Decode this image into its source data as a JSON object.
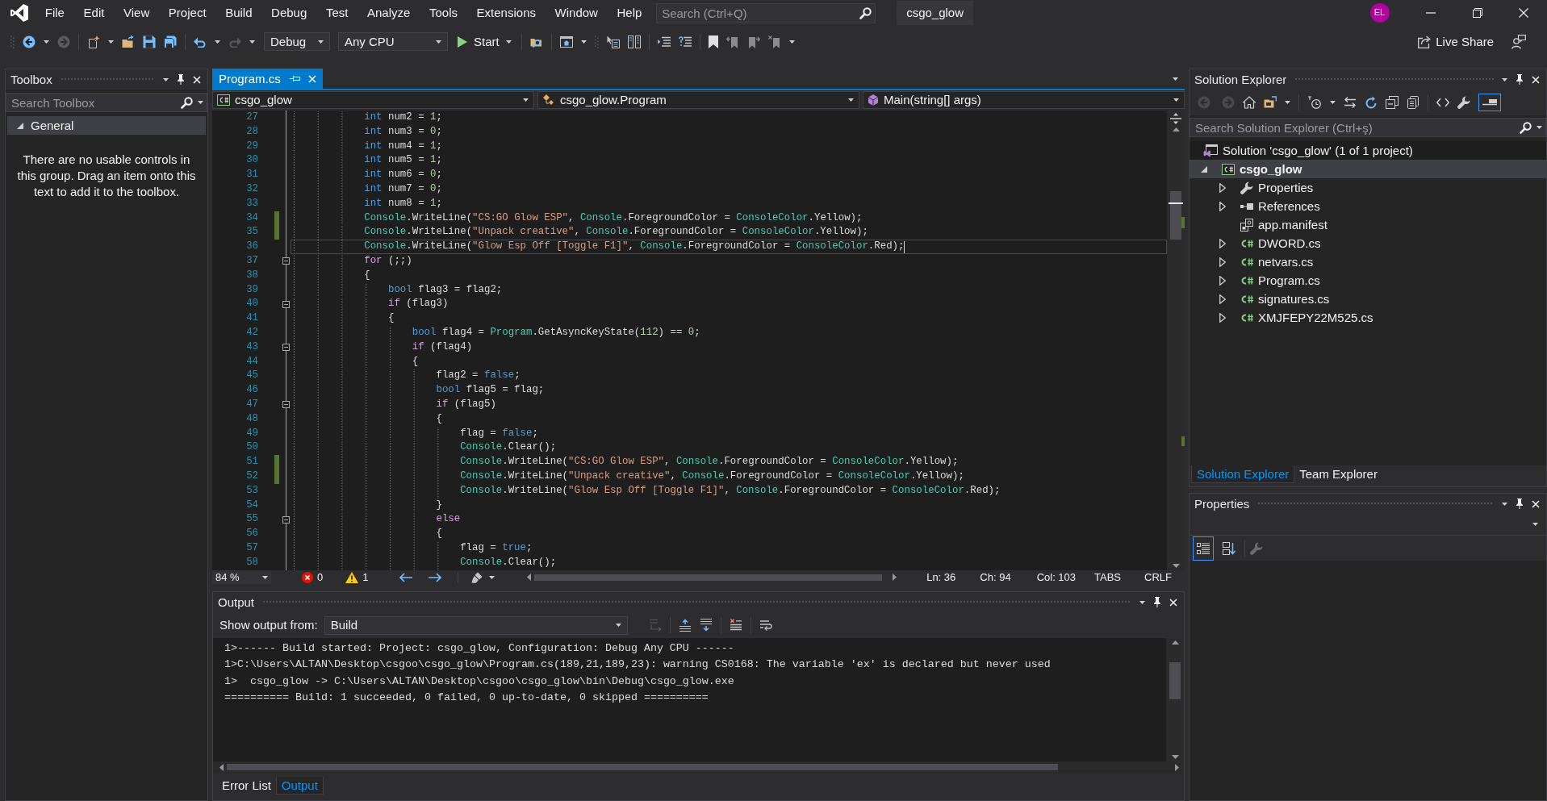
{
  "menu_bar": {
    "items": [
      "File",
      "Edit",
      "View",
      "Project",
      "Build",
      "Debug",
      "Test",
      "Analyze",
      "Tools",
      "Extensions",
      "Window",
      "Help"
    ],
    "search": {
      "placeholder": "Search (Ctrl+Q)"
    },
    "solution_name": "csgo_glow",
    "account_initials": "EL"
  },
  "toolbar": {
    "configuration": "Debug",
    "platform": "Any CPU",
    "start": "Start",
    "live_share": "Live Share"
  },
  "toolbox": {
    "title": "Toolbox",
    "search": {
      "placeholder": "Search Toolbox"
    },
    "groups": [
      {
        "label": "General",
        "expanded": true,
        "message": "There are no usable controls in this group. Drag an item onto this text to add it to the toolbox."
      }
    ]
  },
  "editor": {
    "tabs": [
      {
        "label": "Program.cs",
        "selected": true
      }
    ],
    "navigation": {
      "project": "csgo_glow",
      "type": "csgo_glow.Program",
      "member": "Main(string[] args)"
    },
    "lines": [
      {
        "number": "27",
        "changed": false,
        "current": false,
        "foldable": false,
        "tokens": [
          {
            "kind": "keyword",
            "text": "            int"
          },
          {
            "kind": "plain",
            "text": " num2 = "
          },
          {
            "kind": "number",
            "text": "1"
          },
          {
            "kind": "plain",
            "text": ";"
          }
        ]
      },
      {
        "number": "28",
        "changed": false,
        "current": false,
        "foldable": false,
        "tokens": [
          {
            "kind": "keyword",
            "text": "            int"
          },
          {
            "kind": "plain",
            "text": " num3 = "
          },
          {
            "kind": "number",
            "text": "0"
          },
          {
            "kind": "plain",
            "text": ";"
          }
        ]
      },
      {
        "number": "29",
        "changed": false,
        "current": false,
        "foldable": false,
        "tokens": [
          {
            "kind": "keyword",
            "text": "            int"
          },
          {
            "kind": "plain",
            "text": " num4 = "
          },
          {
            "kind": "number",
            "text": "1"
          },
          {
            "kind": "plain",
            "text": ";"
          }
        ]
      },
      {
        "number": "30",
        "changed": false,
        "current": false,
        "foldable": false,
        "tokens": [
          {
            "kind": "keyword",
            "text": "            int"
          },
          {
            "kind": "plain",
            "text": " num5 = "
          },
          {
            "kind": "number",
            "text": "1"
          },
          {
            "kind": "plain",
            "text": ";"
          }
        ]
      },
      {
        "number": "31",
        "changed": false,
        "current": false,
        "foldable": false,
        "tokens": [
          {
            "kind": "keyword",
            "text": "            int"
          },
          {
            "kind": "plain",
            "text": " num6 = "
          },
          {
            "kind": "number",
            "text": "0"
          },
          {
            "kind": "plain",
            "text": ";"
          }
        ]
      },
      {
        "number": "32",
        "changed": false,
        "current": false,
        "foldable": false,
        "tokens": [
          {
            "kind": "keyword",
            "text": "            int"
          },
          {
            "kind": "plain",
            "text": " num7 = "
          },
          {
            "kind": "number",
            "text": "0"
          },
          {
            "kind": "plain",
            "text": ";"
          }
        ]
      },
      {
        "number": "33",
        "changed": false,
        "current": false,
        "foldable": false,
        "tokens": [
          {
            "kind": "keyword",
            "text": "            int"
          },
          {
            "kind": "plain",
            "text": " num8 = "
          },
          {
            "kind": "number",
            "text": "1"
          },
          {
            "kind": "plain",
            "text": ";"
          }
        ]
      },
      {
        "number": "34",
        "changed": true,
        "current": false,
        "foldable": false,
        "tokens": [
          {
            "kind": "type",
            "text": "            Console"
          },
          {
            "kind": "plain",
            "text": ".WriteLine("
          },
          {
            "kind": "string",
            "text": "\"CS:GO Glow ESP\""
          },
          {
            "kind": "plain",
            "text": ", "
          },
          {
            "kind": "type",
            "text": "Console"
          },
          {
            "kind": "plain",
            "text": ".ForegroundColor = "
          },
          {
            "kind": "type",
            "text": "ConsoleColor"
          },
          {
            "kind": "plain",
            "text": ".Yellow);"
          }
        ]
      },
      {
        "number": "35",
        "changed": true,
        "current": false,
        "foldable": false,
        "tokens": [
          {
            "kind": "type",
            "text": "            Console"
          },
          {
            "kind": "plain",
            "text": ".WriteLine("
          },
          {
            "kind": "string",
            "text": "\"Unpack creative\""
          },
          {
            "kind": "plain",
            "text": ", "
          },
          {
            "kind": "type",
            "text": "Console"
          },
          {
            "kind": "plain",
            "text": ".ForegroundColor = "
          },
          {
            "kind": "type",
            "text": "ConsoleColor"
          },
          {
            "kind": "plain",
            "text": ".Yellow);"
          }
        ]
      },
      {
        "number": "36",
        "changed": false,
        "current": true,
        "foldable": false,
        "tokens": [
          {
            "kind": "type",
            "text": "            Console"
          },
          {
            "kind": "plain",
            "text": ".WriteLine("
          },
          {
            "kind": "string",
            "text": "\"Glow Esp Off [Toggle F1]\""
          },
          {
            "kind": "plain",
            "text": ", "
          },
          {
            "kind": "type",
            "text": "Console"
          },
          {
            "kind": "plain",
            "text": ".ForegroundColor = "
          },
          {
            "kind": "type",
            "text": "ConsoleColor"
          },
          {
            "kind": "plain",
            "text": ".Red);"
          }
        ]
      },
      {
        "number": "37",
        "changed": false,
        "current": false,
        "foldable": true,
        "tokens": [
          {
            "kind": "control",
            "text": "            for"
          },
          {
            "kind": "plain",
            "text": " (;;)"
          }
        ]
      },
      {
        "number": "38",
        "changed": false,
        "current": false,
        "foldable": false,
        "tokens": [
          {
            "kind": "plain",
            "text": "            {"
          }
        ]
      },
      {
        "number": "39",
        "changed": false,
        "current": false,
        "foldable": false,
        "tokens": [
          {
            "kind": "keyword",
            "text": "                bool"
          },
          {
            "kind": "plain",
            "text": " flag3 = flag2;"
          }
        ]
      },
      {
        "number": "40",
        "changed": false,
        "current": false,
        "foldable": true,
        "tokens": [
          {
            "kind": "control",
            "text": "                if"
          },
          {
            "kind": "plain",
            "text": " (flag3)"
          }
        ]
      },
      {
        "number": "41",
        "changed": false,
        "current": false,
        "foldable": false,
        "tokens": [
          {
            "kind": "plain",
            "text": "                {"
          }
        ]
      },
      {
        "number": "42",
        "changed": false,
        "current": false,
        "foldable": false,
        "tokens": [
          {
            "kind": "keyword",
            "text": "                    bool"
          },
          {
            "kind": "plain",
            "text": " flag4 = "
          },
          {
            "kind": "type",
            "text": "Program"
          },
          {
            "kind": "plain",
            "text": ".GetAsyncKeyState("
          },
          {
            "kind": "number",
            "text": "112"
          },
          {
            "kind": "plain",
            "text": ") == "
          },
          {
            "kind": "number",
            "text": "0"
          },
          {
            "kind": "plain",
            "text": ";"
          }
        ]
      },
      {
        "number": "43",
        "changed": false,
        "current": false,
        "foldable": true,
        "tokens": [
          {
            "kind": "control",
            "text": "                    if"
          },
          {
            "kind": "plain",
            "text": " (flag4)"
          }
        ]
      },
      {
        "number": "44",
        "changed": false,
        "current": false,
        "foldable": false,
        "tokens": [
          {
            "kind": "plain",
            "text": "                    {"
          }
        ]
      },
      {
        "number": "45",
        "changed": false,
        "current": false,
        "foldable": false,
        "tokens": [
          {
            "kind": "plain",
            "text": "                        flag2 = "
          },
          {
            "kind": "keyword",
            "text": "false"
          },
          {
            "kind": "plain",
            "text": ";"
          }
        ]
      },
      {
        "number": "46",
        "changed": false,
        "current": false,
        "foldable": false,
        "tokens": [
          {
            "kind": "keyword",
            "text": "                        bool"
          },
          {
            "kind": "plain",
            "text": " flag5 = flag;"
          }
        ]
      },
      {
        "number": "47",
        "changed": false,
        "current": false,
        "foldable": true,
        "tokens": [
          {
            "kind": "control",
            "text": "                        if"
          },
          {
            "kind": "plain",
            "text": " (flag5)"
          }
        ]
      },
      {
        "number": "48",
        "changed": false,
        "current": false,
        "foldable": false,
        "tokens": [
          {
            "kind": "plain",
            "text": "                        {"
          }
        ]
      },
      {
        "number": "49",
        "changed": false,
        "current": false,
        "foldable": false,
        "tokens": [
          {
            "kind": "plain",
            "text": "                            flag = "
          },
          {
            "kind": "keyword",
            "text": "false"
          },
          {
            "kind": "plain",
            "text": ";"
          }
        ]
      },
      {
        "number": "50",
        "changed": false,
        "current": false,
        "foldable": false,
        "tokens": [
          {
            "kind": "type",
            "text": "                            Console"
          },
          {
            "kind": "plain",
            "text": ".Clear();"
          }
        ]
      },
      {
        "number": "51",
        "changed": true,
        "current": false,
        "foldable": false,
        "tokens": [
          {
            "kind": "type",
            "text": "                            Console"
          },
          {
            "kind": "plain",
            "text": ".WriteLine("
          },
          {
            "kind": "string",
            "text": "\"CS:GO Glow ESP\""
          },
          {
            "kind": "plain",
            "text": ", "
          },
          {
            "kind": "type",
            "text": "Console"
          },
          {
            "kind": "plain",
            "text": ".ForegroundColor = "
          },
          {
            "kind": "type",
            "text": "ConsoleColor"
          },
          {
            "kind": "plain",
            "text": ".Yellow);"
          }
        ]
      },
      {
        "number": "52",
        "changed": true,
        "current": false,
        "foldable": false,
        "tokens": [
          {
            "kind": "type",
            "text": "                            Console"
          },
          {
            "kind": "plain",
            "text": ".WriteLine("
          },
          {
            "kind": "string",
            "text": "\"Unpack creative\""
          },
          {
            "kind": "plain",
            "text": ", "
          },
          {
            "kind": "type",
            "text": "Console"
          },
          {
            "kind": "plain",
            "text": ".ForegroundColor = "
          },
          {
            "kind": "type",
            "text": "ConsoleColor"
          },
          {
            "kind": "plain",
            "text": ".Yellow);"
          }
        ]
      },
      {
        "number": "53",
        "changed": false,
        "current": false,
        "foldable": false,
        "tokens": [
          {
            "kind": "type",
            "text": "                            Console"
          },
          {
            "kind": "plain",
            "text": ".WriteLine("
          },
          {
            "kind": "string",
            "text": "\"Glow Esp Off [Toggle F1]\""
          },
          {
            "kind": "plain",
            "text": ", "
          },
          {
            "kind": "type",
            "text": "Console"
          },
          {
            "kind": "plain",
            "text": ".ForegroundColor = "
          },
          {
            "kind": "type",
            "text": "ConsoleColor"
          },
          {
            "kind": "plain",
            "text": ".Red);"
          }
        ]
      },
      {
        "number": "54",
        "changed": false,
        "current": false,
        "foldable": false,
        "tokens": [
          {
            "kind": "plain",
            "text": "                        }"
          }
        ]
      },
      {
        "number": "55",
        "changed": false,
        "current": false,
        "foldable": true,
        "tokens": [
          {
            "kind": "control",
            "text": "                        else"
          }
        ]
      },
      {
        "number": "56",
        "changed": false,
        "current": false,
        "foldable": false,
        "tokens": [
          {
            "kind": "plain",
            "text": "                        {"
          }
        ]
      },
      {
        "number": "57",
        "changed": false,
        "current": false,
        "foldable": false,
        "tokens": [
          {
            "kind": "plain",
            "text": "                            flag = "
          },
          {
            "kind": "keyword",
            "text": "true"
          },
          {
            "kind": "plain",
            "text": ";"
          }
        ]
      },
      {
        "number": "58",
        "changed": false,
        "current": false,
        "foldable": false,
        "tokens": [
          {
            "kind": "type",
            "text": "                            Console"
          },
          {
            "kind": "plain",
            "text": ".Clear();"
          }
        ]
      }
    ],
    "status": {
      "zoom": "84 %",
      "errors": "0",
      "warnings": "1",
      "line": "Ln: 36",
      "character": "Ch: 94",
      "column": "Col: 103",
      "indentation": "TABS",
      "line_endings": "CRLF"
    }
  },
  "output": {
    "title": "Output",
    "source_label": "Show output from:",
    "source": "Build",
    "lines": [
      "1>------ Build started: Project: csgo_glow, Configuration: Debug Any CPU ------",
      "1>C:\\Users\\ALTAN\\Desktop\\csgoo\\csgo_glow\\Program.cs(189,21,189,23): warning CS0168: The variable 'ex' is declared but never used",
      "1>  csgo_glow -> C:\\Users\\ALTAN\\Desktop\\csgoo\\csgo_glow\\bin\\Debug\\csgo_glow.exe",
      "========== Build: 1 succeeded, 0 failed, 0 up-to-date, 0 skipped =========="
    ],
    "tabs": [
      {
        "label": "Error List",
        "selected": false
      },
      {
        "label": "Output",
        "selected": true
      }
    ]
  },
  "solution_explorer": {
    "title": "Solution Explorer",
    "preview_selected_items": true,
    "search": {
      "placeholder": "Search Solution Explorer (Ctrl+ş)"
    },
    "tree": [
      {
        "label": "Solution 'csgo_glow' (1 of 1 project)",
        "kind": "solution",
        "selected": false,
        "children": [
          {
            "label": "csgo_glow",
            "kind": "project",
            "bold": true,
            "expanded": true,
            "selected": true,
            "children": [
              {
                "label": "Properties",
                "kind": "properties",
                "expanded": false,
                "selected": false
              },
              {
                "label": "References",
                "kind": "references",
                "expanded": false,
                "selected": false
              },
              {
                "label": "app.manifest",
                "kind": "manifest",
                "selected": false
              },
              {
                "label": "DWORD.cs",
                "kind": "code_file",
                "expanded": false,
                "selected": false
              },
              {
                "label": "netvars.cs",
                "kind": "code_file",
                "expanded": false,
                "selected": false
              },
              {
                "label": "Program.cs",
                "kind": "code_file",
                "expanded": false,
                "selected": false
              },
              {
                "label": "signatures.cs",
                "kind": "code_file",
                "expanded": false,
                "selected": false
              },
              {
                "label": "XMJFEPY22M525.cs",
                "kind": "code_file",
                "expanded": false,
                "selected": false
              }
            ]
          }
        ]
      }
    ],
    "tabs": [
      {
        "label": "Solution Explorer",
        "selected": true
      },
      {
        "label": "Team Explorer",
        "selected": false
      }
    ]
  },
  "properties": {
    "title": "Properties",
    "categorized": true
  }
}
